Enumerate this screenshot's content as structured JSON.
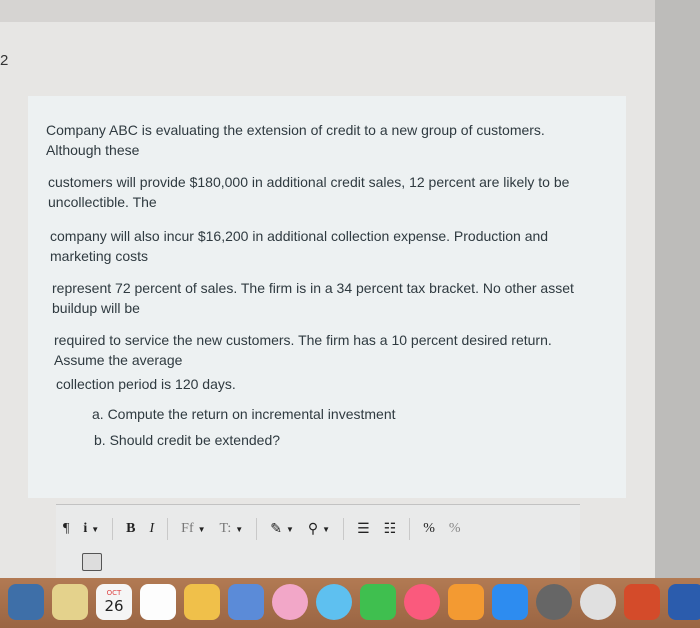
{
  "margin_number": "2",
  "question": {
    "p1_l1": "Company ABC is evaluating the extension of credit to a new group of customers.",
    "p1_l2": "Although these",
    "p2_l1": "customers will provide $180,000 in additional credit sales, 12 percent are likely to be",
    "p2_l2": "uncollectible. The",
    "p3_l1": "company will also incur $16,200 in additional collection expense. Production and",
    "p3_l2": "marketing costs",
    "p4_l1": "represent 72 percent of sales. The firm is in a 34 percent tax bracket. No other asset",
    "p4_l2": "buildup will be",
    "p5_l1": "required to service the new customers. The firm has a 10 percent desired return.",
    "p5_l2": "Assume the average",
    "p6_l1": "collection period is 120 days.",
    "item_a": "a. Compute the return on incremental investment",
    "item_b": "b. Should credit be extended?"
  },
  "toolbar": {
    "paragraph_label": "¶",
    "info_label": "i",
    "bold_label": "B",
    "italic_label": "I",
    "font_label": "Ff",
    "textsize_label": "T:",
    "pen_label": "✎",
    "link_label": "⚲",
    "list_ordered_label": "☰",
    "list_bullet_label": "☷",
    "link2_label": "%",
    "unlink_label": "%"
  },
  "dock": {
    "calendar_day": "26",
    "calendar_month": "OCT"
  },
  "colors": {
    "question_text": "#2f3a40",
    "question_bg": "#edf1f2",
    "dock_bg": "#a86f4b"
  }
}
